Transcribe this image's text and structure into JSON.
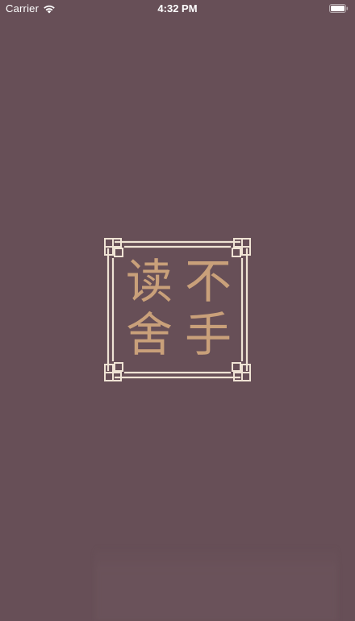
{
  "status_bar": {
    "carrier": "Carrier",
    "time": "4:32 PM",
    "wifi_icon": "wifi-icon",
    "battery_icon": "battery-icon",
    "battery_level": 1.0
  },
  "logo": {
    "chars": [
      "读",
      "舍",
      "不",
      "手"
    ],
    "frame_color": "#efe3d4",
    "text_color": "#c9a07a"
  },
  "colors": {
    "background": "#674f57"
  }
}
